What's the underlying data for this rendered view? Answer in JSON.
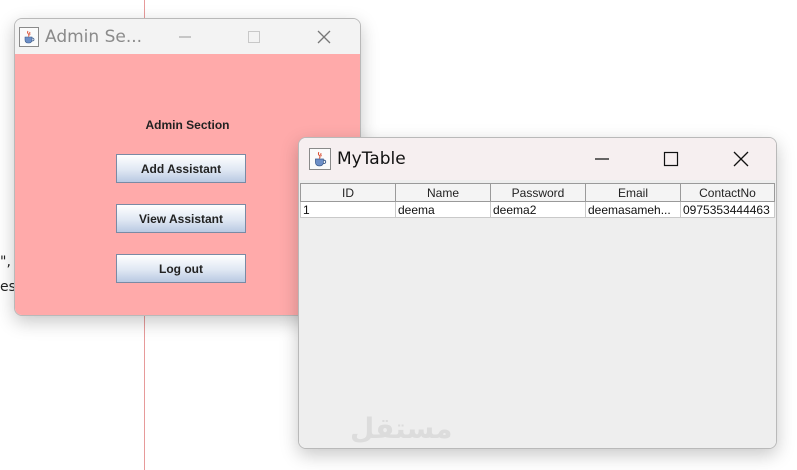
{
  "background": {
    "fragments": [
      "\",",
      "es"
    ],
    "accent_line_color": "#e79a9a"
  },
  "admin_window": {
    "title": "Admin Se...",
    "heading": "Admin Section",
    "buttons": {
      "add": "Add Assistant",
      "view": "View Assistant",
      "logout": "Log out"
    },
    "bg_color": "#ffaaaa"
  },
  "table_window": {
    "title": "MyTable",
    "columns": [
      "ID",
      "Name",
      "Password",
      "Email",
      "ContactNo"
    ],
    "rows": [
      [
        "1",
        "deema",
        "deema2",
        "deemasameh...",
        "0975353444463"
      ]
    ]
  },
  "watermark": "مستقل",
  "icons": {
    "app": "java-cup-icon",
    "minimize": "minimize-icon",
    "maximize": "maximize-icon",
    "close": "close-icon"
  }
}
